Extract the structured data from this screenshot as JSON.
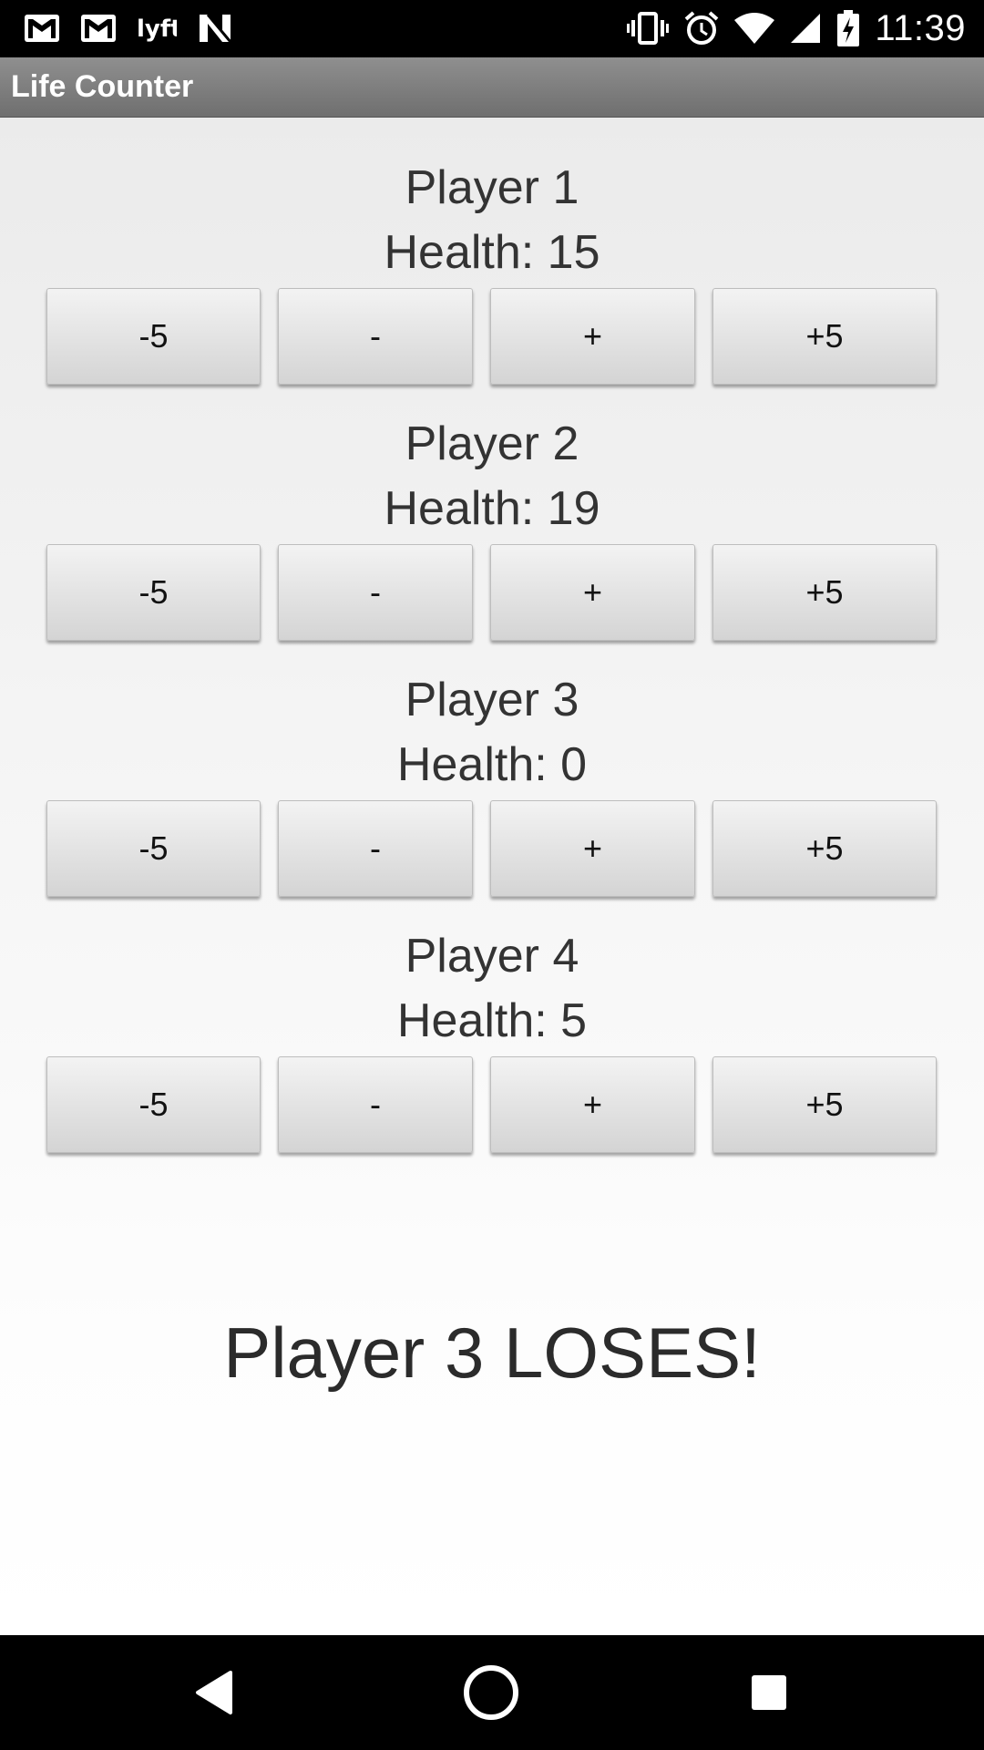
{
  "status_bar": {
    "time": "11:39",
    "left_icons": [
      "gmail-icon",
      "gmail-icon",
      "lyft-icon",
      "n-app-icon"
    ],
    "right_icons": [
      "vibrate-icon",
      "alarm-icon",
      "wifi-icon",
      "signal-icon",
      "battery-charging-icon"
    ]
  },
  "app_bar": {
    "title": "Life Counter",
    "color": "#7f7f7f"
  },
  "buttons": {
    "minus5": "-5",
    "minus1": "-",
    "plus1": "+",
    "plus5": "+5"
  },
  "players": [
    {
      "name": "Player 1",
      "health": "Health: 15"
    },
    {
      "name": "Player 2",
      "health": "Health: 19"
    },
    {
      "name": "Player 3",
      "health": "Health: 0"
    },
    {
      "name": "Player 4",
      "health": "Health: 5"
    }
  ],
  "loser_message": "Player 3 LOSES!",
  "nav_bar": {
    "icons": [
      "back-icon",
      "home-icon",
      "recents-icon"
    ]
  }
}
